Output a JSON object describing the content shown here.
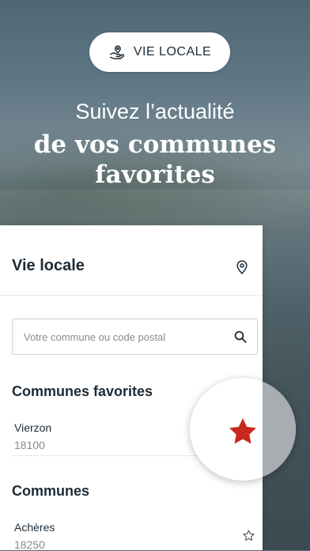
{
  "badge": {
    "label": "VIE LOCALE",
    "icon": "hand-location-icon"
  },
  "headline": {
    "line1": "Suivez l’actualité",
    "line2": "de vos communes",
    "line3": "favorites"
  },
  "panel": {
    "title": "Vie locale",
    "location_icon": "pin-icon",
    "search": {
      "placeholder": "Votre commune ou code postal",
      "value": ""
    },
    "favorites": {
      "title": "Communes favorites",
      "items": [
        {
          "name": "Vierzon",
          "zip": "18100",
          "favorite": true
        }
      ]
    },
    "communes": {
      "title": "Communes",
      "items": [
        {
          "name": "Achères",
          "zip": "18250",
          "favorite": false
        }
      ]
    }
  },
  "colors": {
    "star": "#c8281e",
    "text": "#1d2b36",
    "muted": "#8a8a8a"
  }
}
